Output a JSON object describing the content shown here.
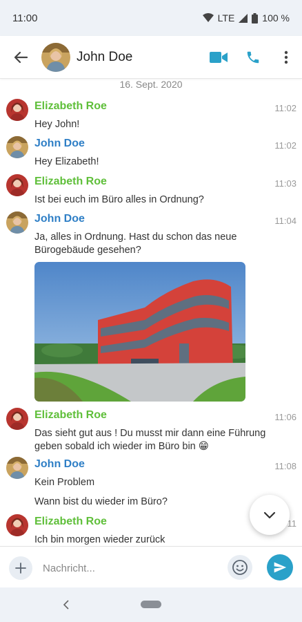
{
  "status_bar": {
    "time": "11:00",
    "network": "LTE",
    "battery": "100 %"
  },
  "header": {
    "contact_name": "John Doe"
  },
  "chat": {
    "date_separator": "16. Sept. 2020",
    "messages": [
      {
        "sender": "Elizabeth Roe",
        "time": "11:02",
        "lines": [
          "Hey John!"
        ]
      },
      {
        "sender": "John Doe",
        "time": "11:02",
        "lines": [
          "Hey Elizabeth!"
        ]
      },
      {
        "sender": "Elizabeth Roe",
        "time": "11:03",
        "lines": [
          "Ist bei euch im Büro alles in Ordnung?"
        ]
      },
      {
        "sender": "John Doe",
        "time": "11:04",
        "lines": [
          "Ja, alles in Ordnung. Hast du schon das neue",
          "Bürogebäude gesehen?"
        ]
      },
      {
        "sender": "Elizabeth Roe",
        "time": "11:06",
        "lines": [
          "Das sieht gut aus ! Du musst mir dann eine Führung",
          "geben sobald ich wieder im Büro bin 😁"
        ]
      },
      {
        "sender": "John Doe",
        "time": "11:08",
        "lines": [
          "Kein Problem",
          "Wann bist du wieder im Büro?"
        ]
      },
      {
        "sender": "Elizabeth Roe",
        "time": "11",
        "lines": [
          "Ich bin morgen wieder zurück"
        ]
      }
    ]
  },
  "composer": {
    "placeholder": "Nachricht..."
  },
  "colors": {
    "accent": "#2aa1c9",
    "elizabeth": "#5fbf3a",
    "john": "#2f7fc6"
  }
}
